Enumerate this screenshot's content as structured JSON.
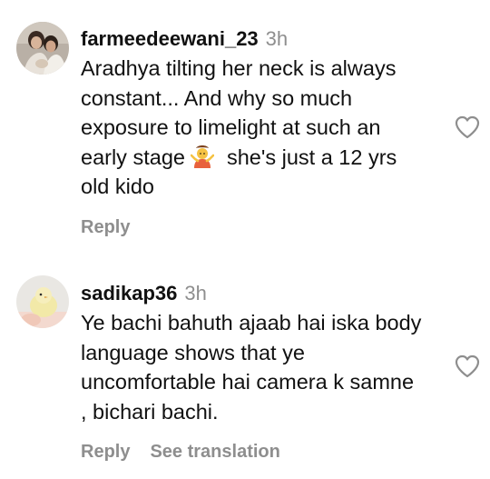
{
  "comments": [
    {
      "username": "farmeedeewani_23",
      "time": "3h",
      "lines": [
        "Aradhya tilting her neck is always",
        "constant... And why so much",
        "exposure to limelight at such an",
        "early stage",
        "she's just a 12 yrs",
        "old kido"
      ],
      "emoji": "person-shrugging-emoji",
      "reply_label": "Reply",
      "avatar": "user-avatar-photo"
    },
    {
      "username": "sadikap36",
      "time": "3h",
      "lines": [
        "Ye bachi bahuth ajaab hai iska body",
        "language shows that ye",
        "uncomfortable hai camera k samne",
        ", bichari bachi."
      ],
      "reply_label": "Reply",
      "see_translation_label": "See translation",
      "avatar": "chick-avatar-photo"
    }
  ],
  "icons": {
    "like": "heart-outline-icon"
  },
  "colors": {
    "text": "#111111",
    "secondary": "#8e8e8e",
    "background": "#ffffff"
  }
}
